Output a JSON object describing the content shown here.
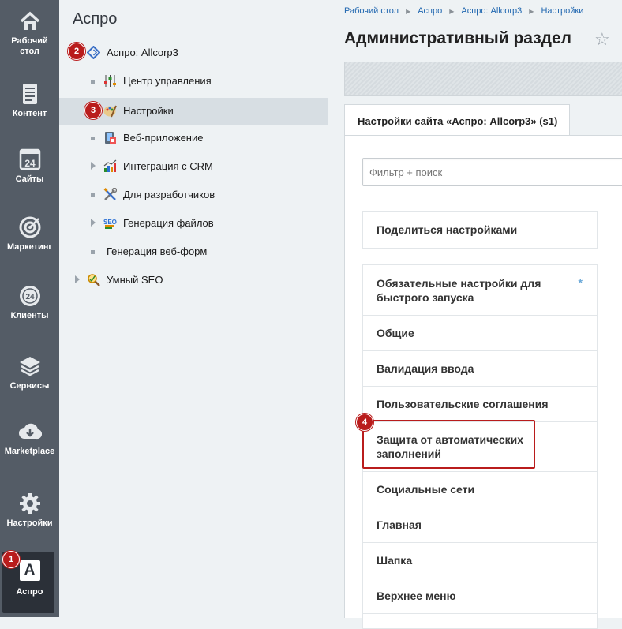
{
  "left_menu": {
    "items": [
      {
        "label_line1": "Рабочий",
        "label_line2": "стол",
        "icon": "home-icon"
      },
      {
        "label_line1": "Контент",
        "label_line2": "",
        "icon": "document-icon"
      },
      {
        "label_line1": "Сайты",
        "label_line2": "",
        "icon": "calendar-24-icon"
      },
      {
        "label_line1": "Маркетинг",
        "label_line2": "",
        "icon": "target-icon"
      },
      {
        "label_line1": "Клиенты",
        "label_line2": "",
        "icon": "clients-24-icon"
      },
      {
        "label_line1": "Сервисы",
        "label_line2": "",
        "icon": "layers-icon"
      },
      {
        "label_line1": "Marketplace",
        "label_line2": "",
        "icon": "cloud-download-icon"
      },
      {
        "label_line1": "Настройки",
        "label_line2": "",
        "icon": "gear-icon"
      },
      {
        "label_line1": "Аспро",
        "label_line2": "",
        "icon": "aspro-a-icon",
        "active": true
      }
    ],
    "active_letter": "A"
  },
  "panel": {
    "title": "Аспро",
    "tree": [
      {
        "label": "Аспро: Allcorp3",
        "icon": "allcorp-diamond-icon",
        "level": 0
      },
      {
        "label": "Центр управления",
        "icon": "control-center-icon",
        "level": 1
      },
      {
        "label": "Настройки",
        "icon": "palette-settings-icon",
        "level": 1,
        "selected": true
      },
      {
        "label": "Веб-приложение",
        "icon": "web-app-icon",
        "level": 1
      },
      {
        "label": "Интеграция с CRM",
        "icon": "crm-chart-icon",
        "level": 1,
        "expandable": true
      },
      {
        "label": "Для разработчиков",
        "icon": "developer-tools-icon",
        "level": 1
      },
      {
        "label": "Генерация файлов",
        "icon": "seo-files-icon",
        "level": 1,
        "expandable": true
      },
      {
        "label": "Генерация веб-форм",
        "icon": "",
        "level": 1
      },
      {
        "label": "Умный SEO",
        "icon": "smart-seo-icon",
        "level": 0,
        "expandable": true
      }
    ]
  },
  "badges": [
    "1",
    "2",
    "3",
    "4"
  ],
  "breadcrumb": [
    "Рабочий стол",
    "Аспро",
    "Аспро: Allcorp3",
    "Настройки"
  ],
  "page_title": "Административный раздел",
  "tab_label": "Настройки сайта «Аспро: Allcorp3» (s1)",
  "filter_placeholder": "Фильтр + поиск",
  "share_settings": "Поделиться настройками",
  "settings_list": [
    {
      "line1": "Обязательные настройки для",
      "line2": "быстрого запуска",
      "required": "*"
    },
    {
      "line1": "Общие",
      "line2": ""
    },
    {
      "line1": "Валидация ввода",
      "line2": ""
    },
    {
      "line1": "Пользовательские соглашения",
      "line2": ""
    },
    {
      "line1": "Защита от автоматических",
      "line2": "заполнений",
      "highlighted": true
    },
    {
      "line1": "Социальные сети",
      "line2": ""
    },
    {
      "line1": "Главная",
      "line2": ""
    },
    {
      "line1": "Шапка",
      "line2": ""
    },
    {
      "line1": "Верхнее меню",
      "line2": ""
    }
  ],
  "colors": {
    "highlight": "#b91c1c",
    "link": "#2067b0",
    "sidebar": "#545c66"
  }
}
